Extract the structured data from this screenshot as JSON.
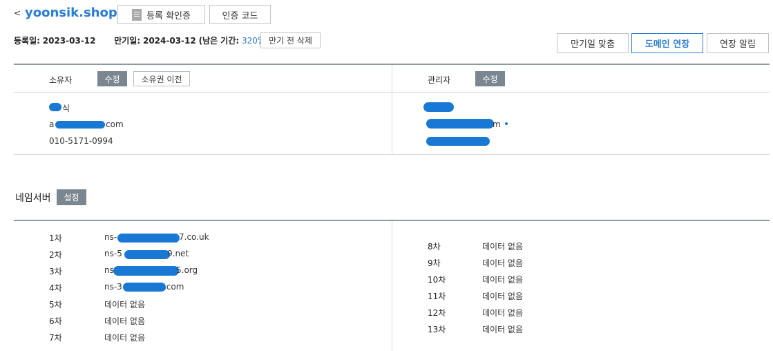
{
  "header": {
    "back": "<",
    "domain": "yoonsik.shop",
    "cert_button": "등록 확인증",
    "auth_button": "인증 코드"
  },
  "dates": {
    "registered_label": "등록일:",
    "registered": "2023-03-12",
    "expiry_label": "만기일:",
    "expiry": "2024-03-12",
    "remaining_open": "(남은 기간:",
    "remaining_days": "320일",
    "remaining_close": ")",
    "delete_button": "만기 전 삭제"
  },
  "actions": {
    "match_expiry": "만기일 맞춤",
    "extend": "도메인 연장",
    "extend_alert": "연장 알림"
  },
  "owner": {
    "label": "소유자",
    "edit": "수정",
    "transfer": "소유권 이전",
    "name_visible": "식",
    "email_visible": "a",
    "email_tail": "com",
    "phone": "010-5171-0994"
  },
  "admin": {
    "label": "관리자",
    "edit": "수정",
    "email_tail": "m"
  },
  "nameserver": {
    "title": "네임서버",
    "setup": "설정",
    "left": [
      {
        "num": "1차",
        "prefix": "ns-",
        "suffix": "7.co.uk"
      },
      {
        "num": "2차",
        "prefix": "ns-5",
        "suffix": "9.net"
      },
      {
        "num": "3차",
        "prefix": "ns",
        "suffix": "5.org"
      },
      {
        "num": "4차",
        "prefix": "ns-3",
        "suffix": ".com"
      },
      {
        "num": "5차",
        "value": "데이터 없음"
      },
      {
        "num": "6차",
        "value": "데이터 없음"
      },
      {
        "num": "7차",
        "value": "데이터 없음"
      }
    ],
    "right": [
      {
        "num": "8차",
        "value": "데이터 없음"
      },
      {
        "num": "9차",
        "value": "데이터 없음"
      },
      {
        "num": "10차",
        "value": "데이터 없음"
      },
      {
        "num": "11차",
        "value": "데이터 없음"
      },
      {
        "num": "12차",
        "value": "데이터 없음"
      },
      {
        "num": "13차",
        "value": "데이터 없음"
      }
    ]
  },
  "colors": {
    "accent": "#2b7cd3",
    "tag": "#7b8790",
    "redaction": "#1878d4"
  }
}
